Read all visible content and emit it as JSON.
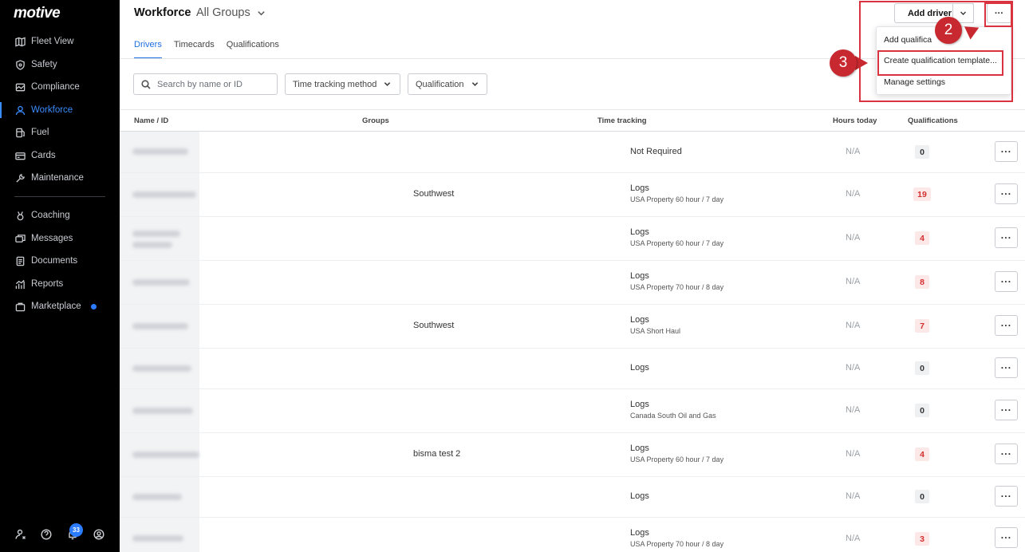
{
  "sidebar": {
    "logo": "motive",
    "items": [
      {
        "label": "Fleet View",
        "icon": "map-icon"
      },
      {
        "label": "Safety",
        "icon": "shield-icon"
      },
      {
        "label": "Compliance",
        "icon": "compliance-icon"
      },
      {
        "label": "Workforce",
        "icon": "person-icon",
        "active": true
      },
      {
        "label": "Fuel",
        "icon": "fuel-icon"
      },
      {
        "label": "Cards",
        "icon": "card-icon"
      },
      {
        "label": "Maintenance",
        "icon": "wrench-icon"
      },
      {
        "label": "Coaching",
        "icon": "medal-icon"
      },
      {
        "label": "Messages",
        "icon": "messages-icon"
      },
      {
        "label": "Documents",
        "icon": "document-icon"
      },
      {
        "label": "Reports",
        "icon": "reports-icon"
      },
      {
        "label": "Marketplace",
        "icon": "bag-icon"
      }
    ],
    "notification_count": "33"
  },
  "header": {
    "title": "Workforce",
    "group_select": "All Groups",
    "add_driver_label": "Add driver",
    "more_label": "···"
  },
  "tabs": [
    "Drivers",
    "Timecards",
    "Qualifications"
  ],
  "filters": {
    "search_placeholder": "Search by name or ID",
    "time_tracking_label": "Time tracking method",
    "qualification_label": "Qualification"
  },
  "table": {
    "columns": [
      "Name / ID",
      "Groups",
      "Time tracking",
      "Hours today",
      "Qualifications"
    ],
    "rows": [
      {
        "group": "",
        "tt_main": "Not Required",
        "tt_sub": "",
        "hours": "N/A",
        "quals": "0"
      },
      {
        "group": "Southwest",
        "tt_main": "Logs",
        "tt_sub": "USA Property 60 hour / 7 day",
        "hours": "N/A",
        "quals": "19"
      },
      {
        "group": "",
        "tt_main": "Logs",
        "tt_sub": "USA Property 60 hour / 7 day",
        "hours": "N/A",
        "quals": "4"
      },
      {
        "group": "",
        "tt_main": "Logs",
        "tt_sub": "USA Property 70 hour / 8 day",
        "hours": "N/A",
        "quals": "8"
      },
      {
        "group": "Southwest",
        "tt_main": "Logs",
        "tt_sub": "USA Short Haul",
        "hours": "N/A",
        "quals": "7"
      },
      {
        "group": "",
        "tt_main": "Logs",
        "tt_sub": "",
        "hours": "N/A",
        "quals": "0"
      },
      {
        "group": "",
        "tt_main": "Logs",
        "tt_sub": "Canada South Oil and Gas",
        "hours": "N/A",
        "quals": "0"
      },
      {
        "group": "bisma test 2",
        "tt_main": "Logs",
        "tt_sub": "USA Property 60 hour / 7 day",
        "hours": "N/A",
        "quals": "4"
      },
      {
        "group": "",
        "tt_main": "Logs",
        "tt_sub": "",
        "hours": "N/A",
        "quals": "0"
      },
      {
        "group": "",
        "tt_main": "Logs",
        "tt_sub": "USA Property 70 hour / 8 day",
        "hours": "N/A",
        "quals": "3"
      }
    ],
    "row_menu_label": "···"
  },
  "dropdown": {
    "items": [
      "Add qualifica",
      "Create qualification template...",
      "Manage settings"
    ]
  },
  "annotations": {
    "step2": "2",
    "step3": "3",
    "highlight_color": "#d9333f"
  },
  "colors": {
    "accent": "#1f6fe0",
    "sidebar_bg": "#000000",
    "badge_red": "#d32f2f"
  }
}
